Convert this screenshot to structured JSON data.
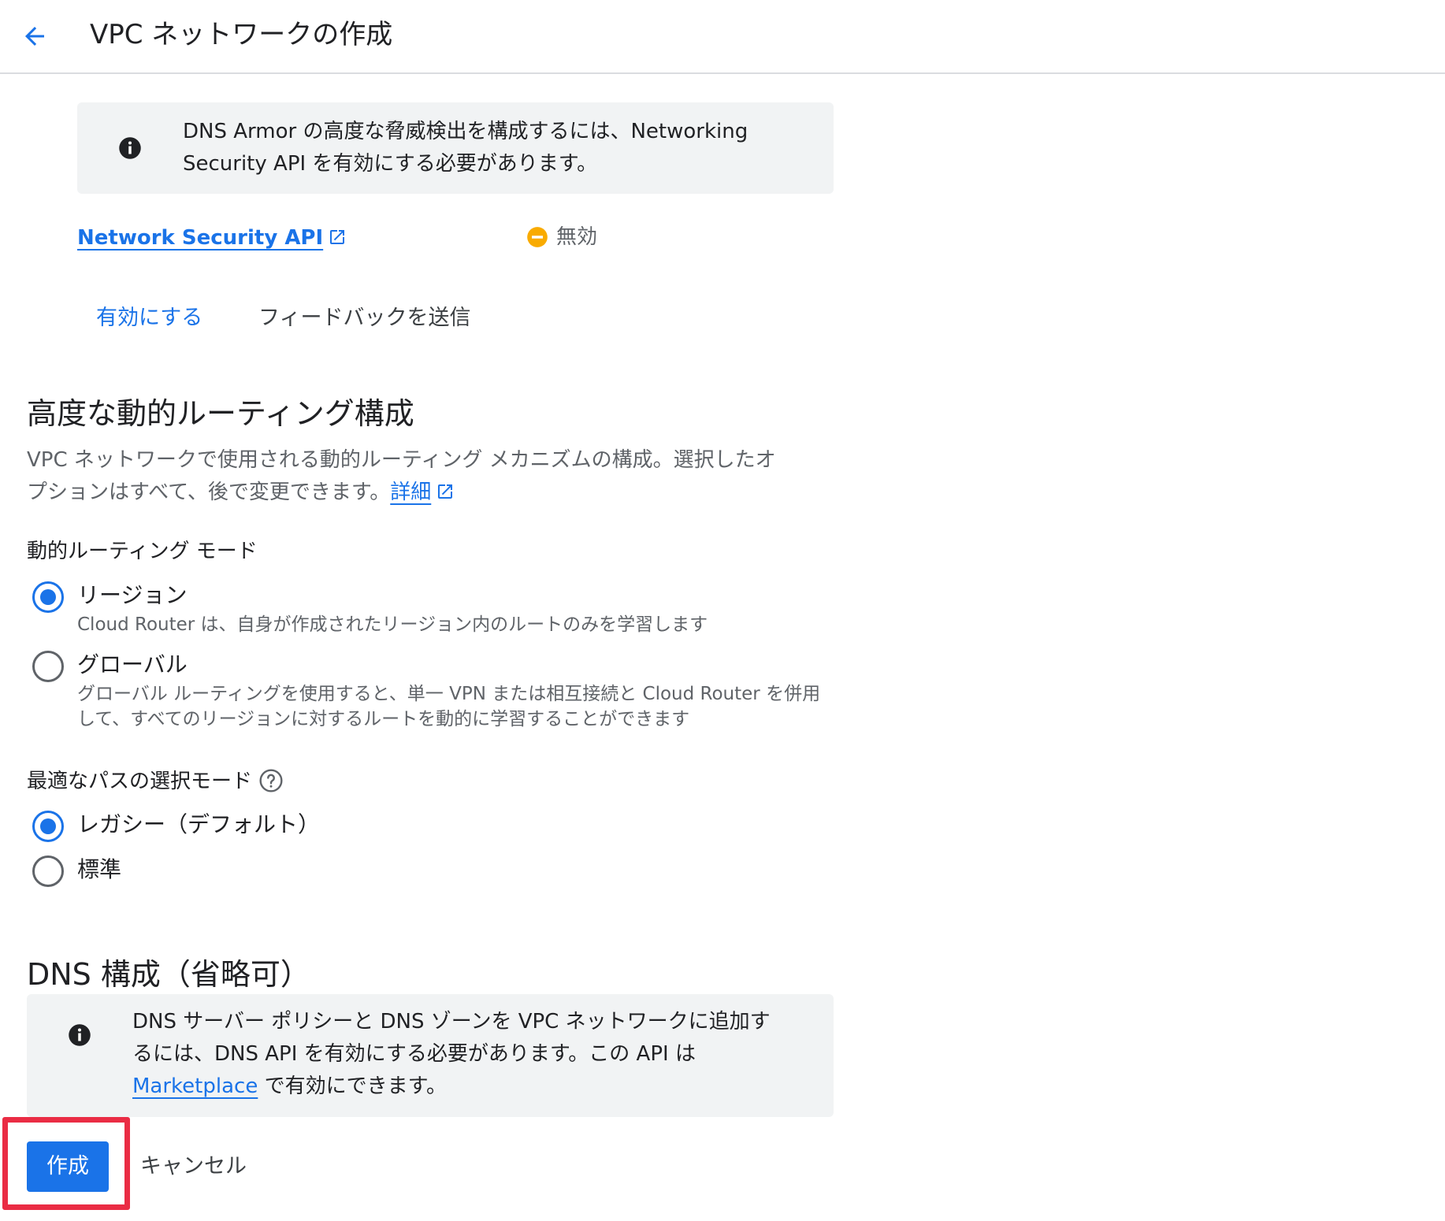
{
  "header": {
    "back_icon": "arrow-back-icon",
    "title": "VPC ネットワークの作成"
  },
  "dns_armor_notice": {
    "icon": "info-icon",
    "text_line1": "DNS Armor の高度な脅威検出を構成するには、Networking",
    "text_line2": "Security API を有効にする必要があります。"
  },
  "network_security_api": {
    "link_label": "Network Security API",
    "link_icon": "open-in-new-icon",
    "status_icon": "disabled-status-icon",
    "status_label": "無効",
    "status_color": "#f9ab00"
  },
  "api_actions": {
    "enable_label": "有効にする",
    "feedback_label": "フィードバックを送信"
  },
  "dynamic_routing": {
    "title": "高度な動的ルーティング構成",
    "description_line1": "VPC ネットワークで使用される動的ルーティング メカニズムの構成。選択したオ",
    "description_line2": "プションはすべて、後で変更できます。",
    "details_link": "詳細",
    "mode_label": "動的ルーティング モード",
    "options": [
      {
        "label": "リージョン",
        "description_line1": "Cloud Router は、自身が作成されたリージョン内のルートのみを学習します",
        "checked": true
      },
      {
        "label": "グローバル",
        "description_line1": "グローバル ルーティングを使用すると、単一 VPN または相互接続と Cloud Router を併用",
        "description_line2": "して、すべてのリージョンに対するルートを動的に学習することができます",
        "checked": false
      }
    ],
    "best_path_label": "最適なパスの選択モード",
    "best_path_help_icon": "help-icon",
    "best_path_options": [
      {
        "label": "レガシー（デフォルト）",
        "checked": true
      },
      {
        "label": "標準",
        "checked": false
      }
    ]
  },
  "dns_config": {
    "title": "DNS 構成（省略可）",
    "notice_icon": "info-icon",
    "notice_line1": "DNS サーバー ポリシーと DNS ゾーンを VPC ネットワークに追加す",
    "notice_line2": "るには、DNS API を有効にする必要があります。この API は",
    "notice_link": "Marketplace",
    "notice_line3_suffix": " で有効にできます。"
  },
  "footer": {
    "create_label": "作成",
    "cancel_label": "キャンセル",
    "highlight_color": "#ea2c44"
  },
  "colors": {
    "accent": "#1a73e8",
    "info_background": "#f1f3f4",
    "secondary_text": "#5f6368"
  }
}
